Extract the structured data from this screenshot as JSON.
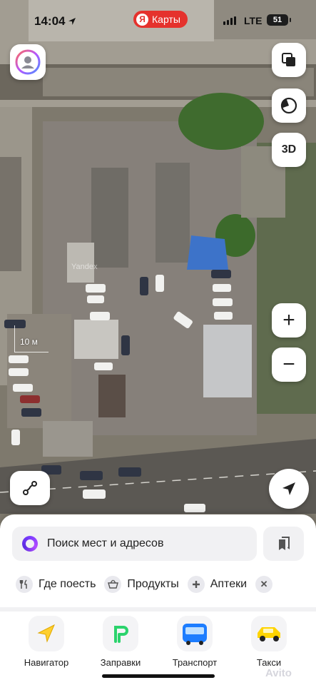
{
  "status_bar": {
    "time": "14:04",
    "network": "LTE",
    "battery": "51"
  },
  "app": {
    "brand_letter": "Я",
    "brand_name": "Карты"
  },
  "map": {
    "watermark": "Yandex",
    "scale_label": "10 м",
    "controls": {
      "layers_icon": "layers-icon",
      "bookmark_style_icon": "style-icon",
      "three_d_label": "3D",
      "zoom_in_label": "+",
      "zoom_out_label": "−"
    }
  },
  "search": {
    "placeholder": "Поиск мест и адресов"
  },
  "categories": [
    {
      "label": "Где поесть",
      "icon": "fork-knife-icon"
    },
    {
      "label": "Продукты",
      "icon": "basket-icon"
    },
    {
      "label": "Аптеки",
      "icon": "pharmacy-cross-icon"
    }
  ],
  "services": [
    {
      "label": "Навигатор",
      "icon": "navigator-arrow-icon"
    },
    {
      "label": "Заправки",
      "icon": "fuel-icon"
    },
    {
      "label": "Транспорт",
      "icon": "bus-icon"
    },
    {
      "label": "Такси",
      "icon": "taxi-car-icon"
    }
  ],
  "watermark_overlay": "Avito",
  "colors": {
    "brand_red": "#e5322d",
    "alice_purple": "#7b3cff",
    "navigator_yellow": "#ffcf2e",
    "fuel_green": "#2bd36c",
    "transport_blue": "#1d7dff",
    "taxi_yellow": "#ffd400"
  }
}
